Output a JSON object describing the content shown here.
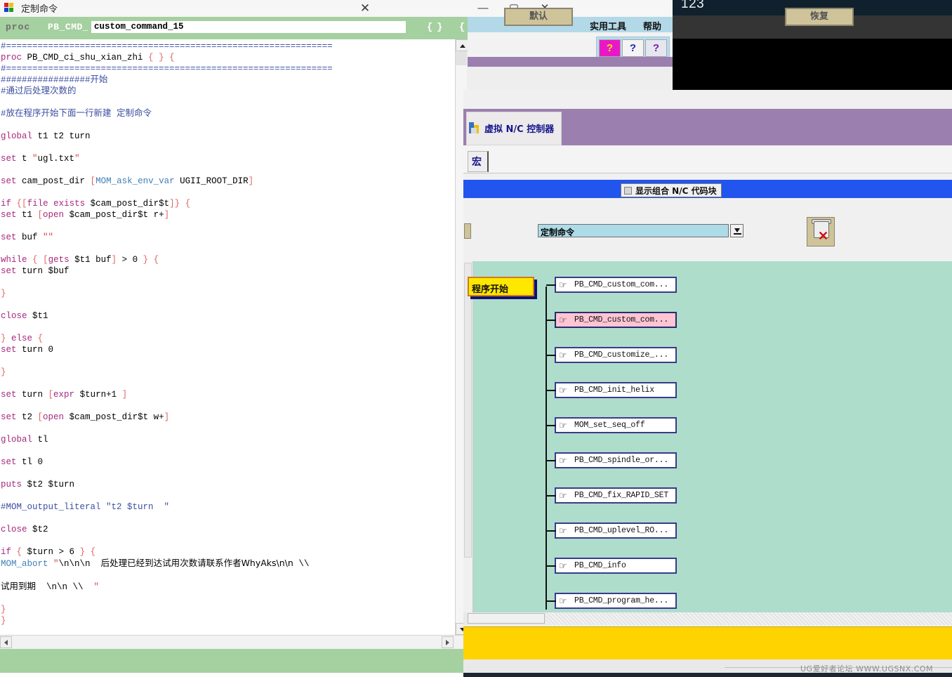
{
  "desktop": {
    "top_text": "123"
  },
  "custom_command_dialog": {
    "title": "定制命令",
    "close_label": "✕",
    "proc_keyword": "proc",
    "proc_prefix": "PB_CMD_",
    "proc_name_value": "custom_command_15",
    "proc_name_placeholder": "custom_command_15",
    "brace_open_args": "{",
    "brace_close_args": "}",
    "brace_body": "{",
    "code": "#==============================================================\nproc PB_CMD_ci_shu_xian_zhi { } {\n#==============================================================\n#################开始\n#通过后处理次数的\n\n#放在程序开始下面一行新建 定制命令\n\nglobal t1 t2 turn\n\nset t \"ugl.txt\"\n\nset cam_post_dir [MOM_ask_env_var UGII_ROOT_DIR]\n\nif {[file exists $cam_post_dir$t]} {\nset t1 [open $cam_post_dir$t r+]\n\nset buf \"\"\n\nwhile { [gets $t1 buf] > 0 } {\nset turn $buf\n\n}\n\nclose $t1\n\n} else {\nset turn 0\n\n}\n\nset turn [expr $turn+1 ]\n\nset t2 [open $cam_post_dir$t w+]\n\nglobal tl\n\nset tl 0\n\nputs $t2 $turn\n\n#MOM_output_literal \"t2 $turn  \"\n\nclose $t2\n\nif { $turn > 6 } {\nMOM_abort \"\\n\\n\\n  后处理已经到达试用次数请联系作者WhyAks\\n\\n \\\\\n\n试用到期  \\n\\n \\\\  \"\n\n}\n}",
    "hscroll_left_arrow": "◀",
    "hscroll_right_arrow": "▶"
  },
  "utility_window": {
    "minimize_label": "—",
    "maximize_label": "▢",
    "close_label": "✕",
    "menus": [
      {
        "label": "实用工具"
      },
      {
        "label": "帮助"
      }
    ],
    "toolbar_icons": [
      {
        "name": "help-balloon-icon",
        "glyph": "?"
      },
      {
        "name": "context-help-pointer-icon",
        "glyph": "?"
      },
      {
        "name": "help-book-icon",
        "glyph": "?"
      }
    ]
  },
  "post_builder": {
    "tab_label": "虚拟 N/C 控制器",
    "subtab_label": "宏",
    "show_combined_checkbox_label": "显示组合 N/C 代码块",
    "show_combined_checked": false,
    "combo_value": "定制命令",
    "combo_arrow": "▼",
    "trash_icon_name": "delete-trash-icon",
    "start_node_label": "程序开始",
    "tree_items": [
      {
        "label": "PB_CMD_custom_com...",
        "selected": false
      },
      {
        "label": "PB_CMD_custom_com...",
        "selected": true
      },
      {
        "label": "PB_CMD_customize_...",
        "selected": false
      },
      {
        "label": "PB_CMD_init_helix",
        "selected": false
      },
      {
        "label": "MOM_set_seq_off",
        "selected": false
      },
      {
        "label": "PB_CMD_spindle_or...",
        "selected": false
      },
      {
        "label": "PB_CMD_fix_RAPID_SET",
        "selected": false
      },
      {
        "label": "PB_CMD_uplevel_RO...",
        "selected": false
      },
      {
        "label": "PB_CMD_info",
        "selected": false
      },
      {
        "label": "PB_CMD_program_he...",
        "selected": false
      }
    ],
    "hand_icon_glyph": "☞",
    "buttons": {
      "default_label": "默认",
      "restore_label": "恢复"
    },
    "watermark": "UG爱好者论坛 WWW.UGSNX.COM"
  },
  "colors": {
    "proc_bar_green": "#a5d0a0",
    "tree_canvas_green": "#aeddcb",
    "action_bar_yellow": "#ffd300",
    "selected_item_pink": "#ffc5d4",
    "tab_purple": "#9b7fae",
    "blue_bar": "#2255ee"
  }
}
